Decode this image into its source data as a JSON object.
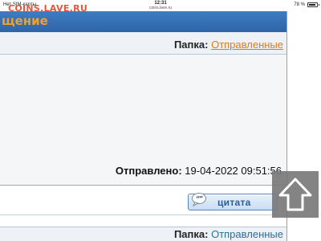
{
  "status_bar": {
    "carrier": "Нет SIM-карты",
    "time": "12:31",
    "url": "coins.lave.ru",
    "battery": "78 %"
  },
  "watermark": "COINS.LAVE.RU",
  "header": {
    "title": "щение"
  },
  "folder_top": {
    "label": "Папка:",
    "link": "Отправленные"
  },
  "message": {
    "sent_label": "Отправлено:",
    "sent_value": "19-04-2022 09:51:56"
  },
  "actions": {
    "quote_label": "цитата"
  },
  "folder_bottom": {
    "label": "Папка:",
    "link": "Отправленные"
  },
  "icons": {
    "quote": "speech-bubble-icon",
    "scroll_top": "arrow-up-icon",
    "battery": "battery-icon"
  },
  "colors": {
    "header_bg": "#3a76ba",
    "header_text": "#f0a030",
    "watermark": "#e8553a",
    "link_orange": "#e07a18",
    "link_teal": "#2b6f9a"
  }
}
